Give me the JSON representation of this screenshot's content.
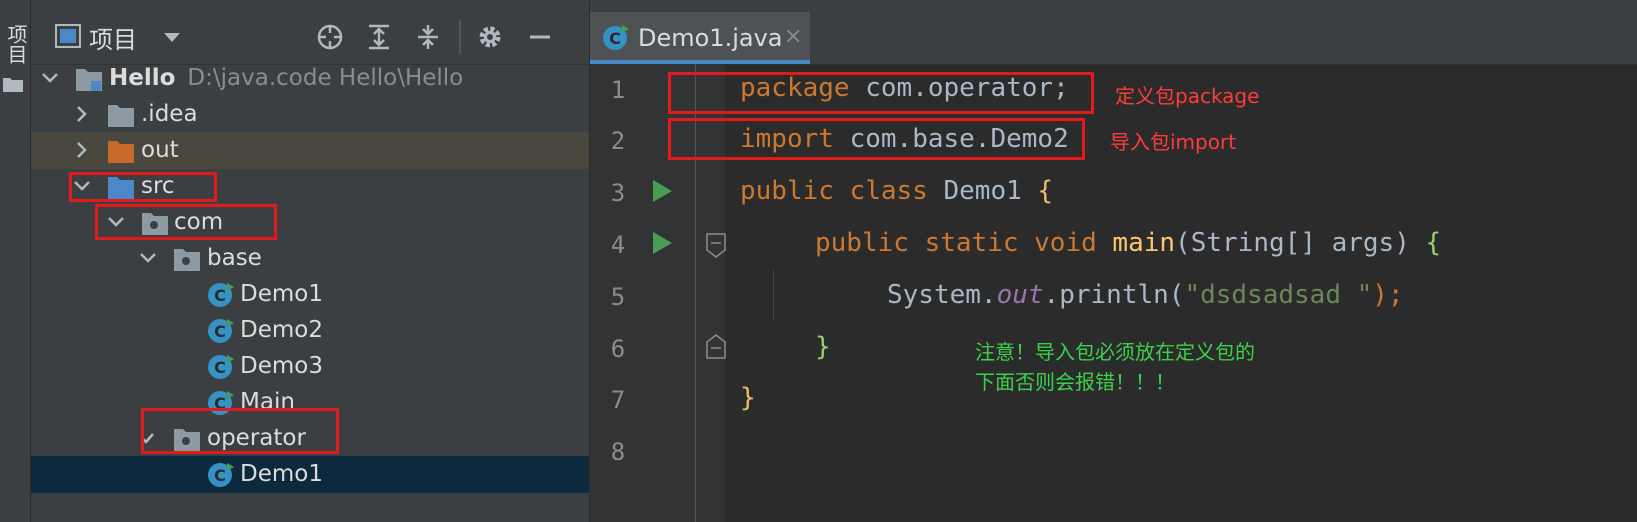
{
  "tool_strip": {
    "label": "项目"
  },
  "project_panel": {
    "title": "项目",
    "tree": [
      {
        "label": "Hello",
        "path": "D:\\java.code Hello\\Hello"
      },
      {
        "label": ".idea"
      },
      {
        "label": "out"
      },
      {
        "label": "src"
      },
      {
        "label": "com"
      },
      {
        "label": "base"
      },
      {
        "label": "Demo1"
      },
      {
        "label": "Demo2"
      },
      {
        "label": "Demo3"
      },
      {
        "label": "Main"
      },
      {
        "label": "operator"
      },
      {
        "label": "Demo1"
      }
    ]
  },
  "editor": {
    "tab": {
      "name": "Demo1.java",
      "close": "×"
    },
    "line_numbers": [
      "1",
      "2",
      "3",
      "4",
      "5",
      "6",
      "7",
      "8"
    ],
    "code": {
      "l1_kw": "package",
      "l1_rest": " com.operator;",
      "l2_kw": "import",
      "l2_rest": " com.base.Demo2",
      "l3_kw": "public class",
      "l3_name": " Demo1 ",
      "l3_brace": "{",
      "l4_kw": "public static void",
      "l4_fn": " main",
      "l4_rest": "(String[] args) ",
      "l4_brace": "{",
      "l5_a": "System.",
      "l5_out": "out",
      "l5_b": ".println(",
      "l5_str": "\"dsdsadsad \"",
      "l5_c": ");",
      "l6_brace": "}",
      "l7_brace": "}"
    },
    "annotations": {
      "package_note": "定义包package",
      "import_note": "导入包import",
      "warning_line1": "注意！导入包必须放在定义包的",
      "warning_line2": "下面否则会报错！！！"
    }
  },
  "colors": {
    "keyword": "#cc7832",
    "function": "#ffc66d",
    "string": "#6a8759",
    "static_field": "#9876aa",
    "highlight_box": "#e21a1a",
    "annotation_red": "#ff3b3b",
    "annotation_green": "#3bd14a",
    "run_icon": "#499c54"
  }
}
